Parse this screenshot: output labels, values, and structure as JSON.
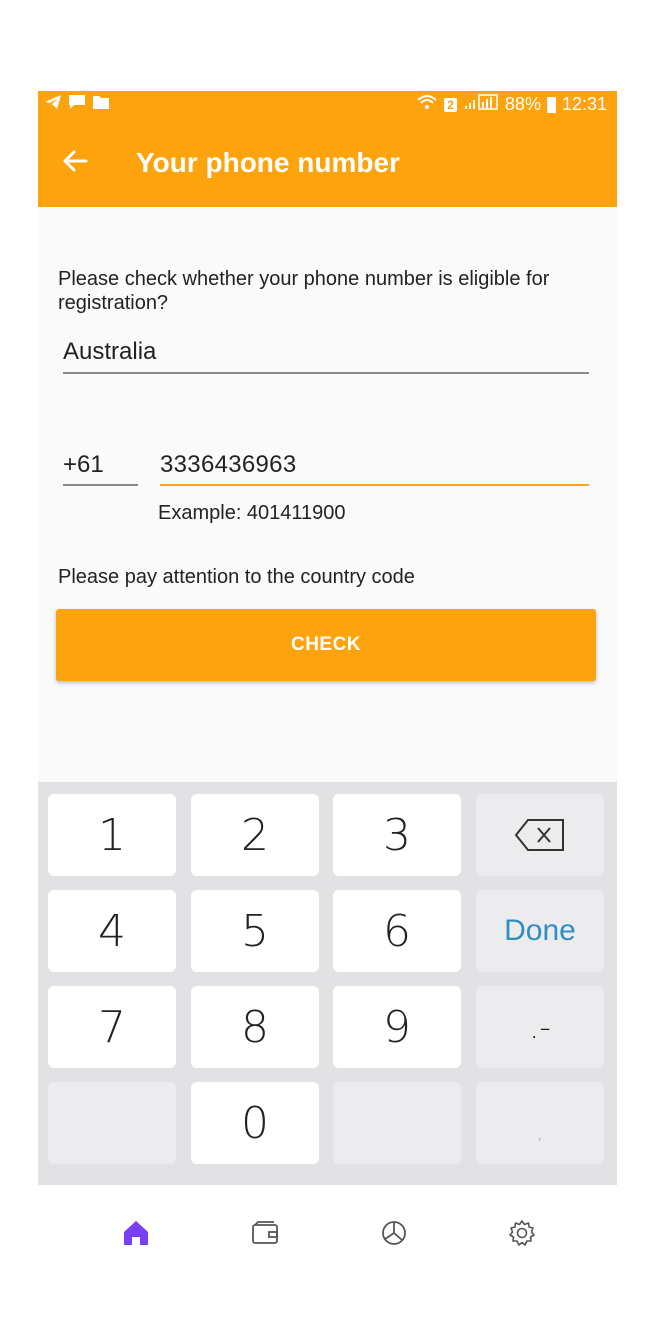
{
  "status_bar": {
    "battery": "88%",
    "time": "12:31",
    "sim": "2"
  },
  "app_bar": {
    "title": "Your phone number"
  },
  "form": {
    "prompt": "Please check whether your phone number is eligible for registration?",
    "country": "Australia",
    "country_code": "+61",
    "phone_number": "3336436963",
    "example": "Example: 401411900",
    "note": "Please pay attention to the country code",
    "check_label": "CHECK"
  },
  "keyboard": {
    "keys": [
      "1",
      "2",
      "3",
      "4",
      "5",
      "6",
      "7",
      "8",
      "9",
      "0"
    ],
    "done_label": "Done",
    "punct_label": ".-",
    "comma_label": ","
  },
  "colors": {
    "accent": "#fda30e",
    "nav_active": "#7b3ff2",
    "done_blue": "#2f8fc4"
  }
}
